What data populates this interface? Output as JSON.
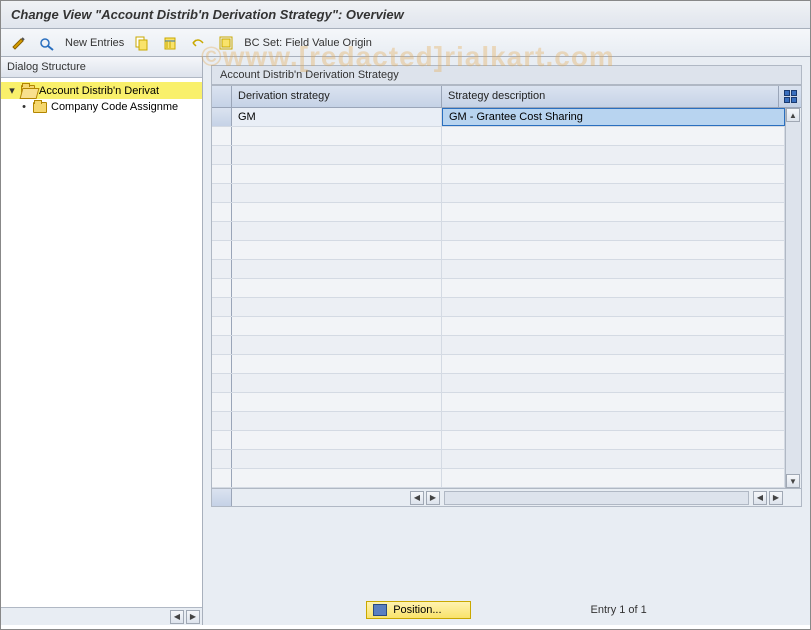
{
  "title": "Change View \"Account Distrib'n Derivation Strategy\": Overview",
  "toolbar": {
    "new_entries": "New Entries",
    "bc_set_label": "BC Set: Field Value Origin"
  },
  "sidebar": {
    "title": "Dialog Structure",
    "items": [
      {
        "label": "Account Distrib'n Derivat",
        "selected": true,
        "open": true
      },
      {
        "label": "Company Code Assignme",
        "selected": false,
        "open": false
      }
    ]
  },
  "panel": {
    "title": "Account Distrib'n Derivation Strategy",
    "columns": {
      "col1": "Derivation strategy",
      "col2": "Strategy description"
    },
    "rows": [
      {
        "strategy": "GM",
        "description": "GM - Grantee Cost Sharing"
      }
    ],
    "empty_row_count": 19
  },
  "footer": {
    "position_btn": "Position...",
    "entry_text": "Entry 1 of 1"
  },
  "watermark": "©www.[redacted]rialkart.com"
}
